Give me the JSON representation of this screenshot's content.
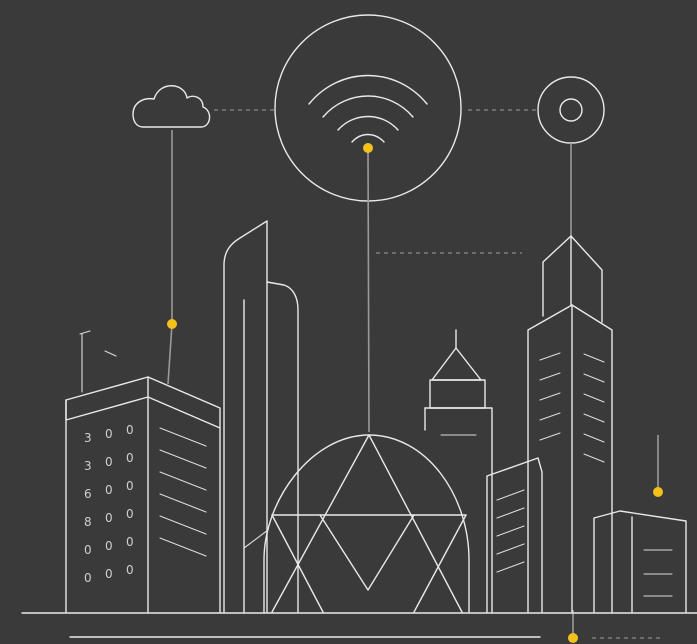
{
  "scene": {
    "background": "#3a3a3a",
    "line_color": "#e9e9e9",
    "accent_color": "#f2c21b",
    "icons": [
      "cloud-icon",
      "wifi-icon",
      "target-icon"
    ],
    "window_glyphs": {
      "tower_left": [
        [
          "3",
          "0",
          "0"
        ],
        [
          "3",
          "0",
          "0"
        ],
        [
          "6",
          "0",
          "0"
        ],
        [
          "8",
          "0",
          "0"
        ],
        [
          "0",
          "0",
          "0"
        ],
        [
          "0",
          "0",
          "0"
        ]
      ]
    }
  }
}
